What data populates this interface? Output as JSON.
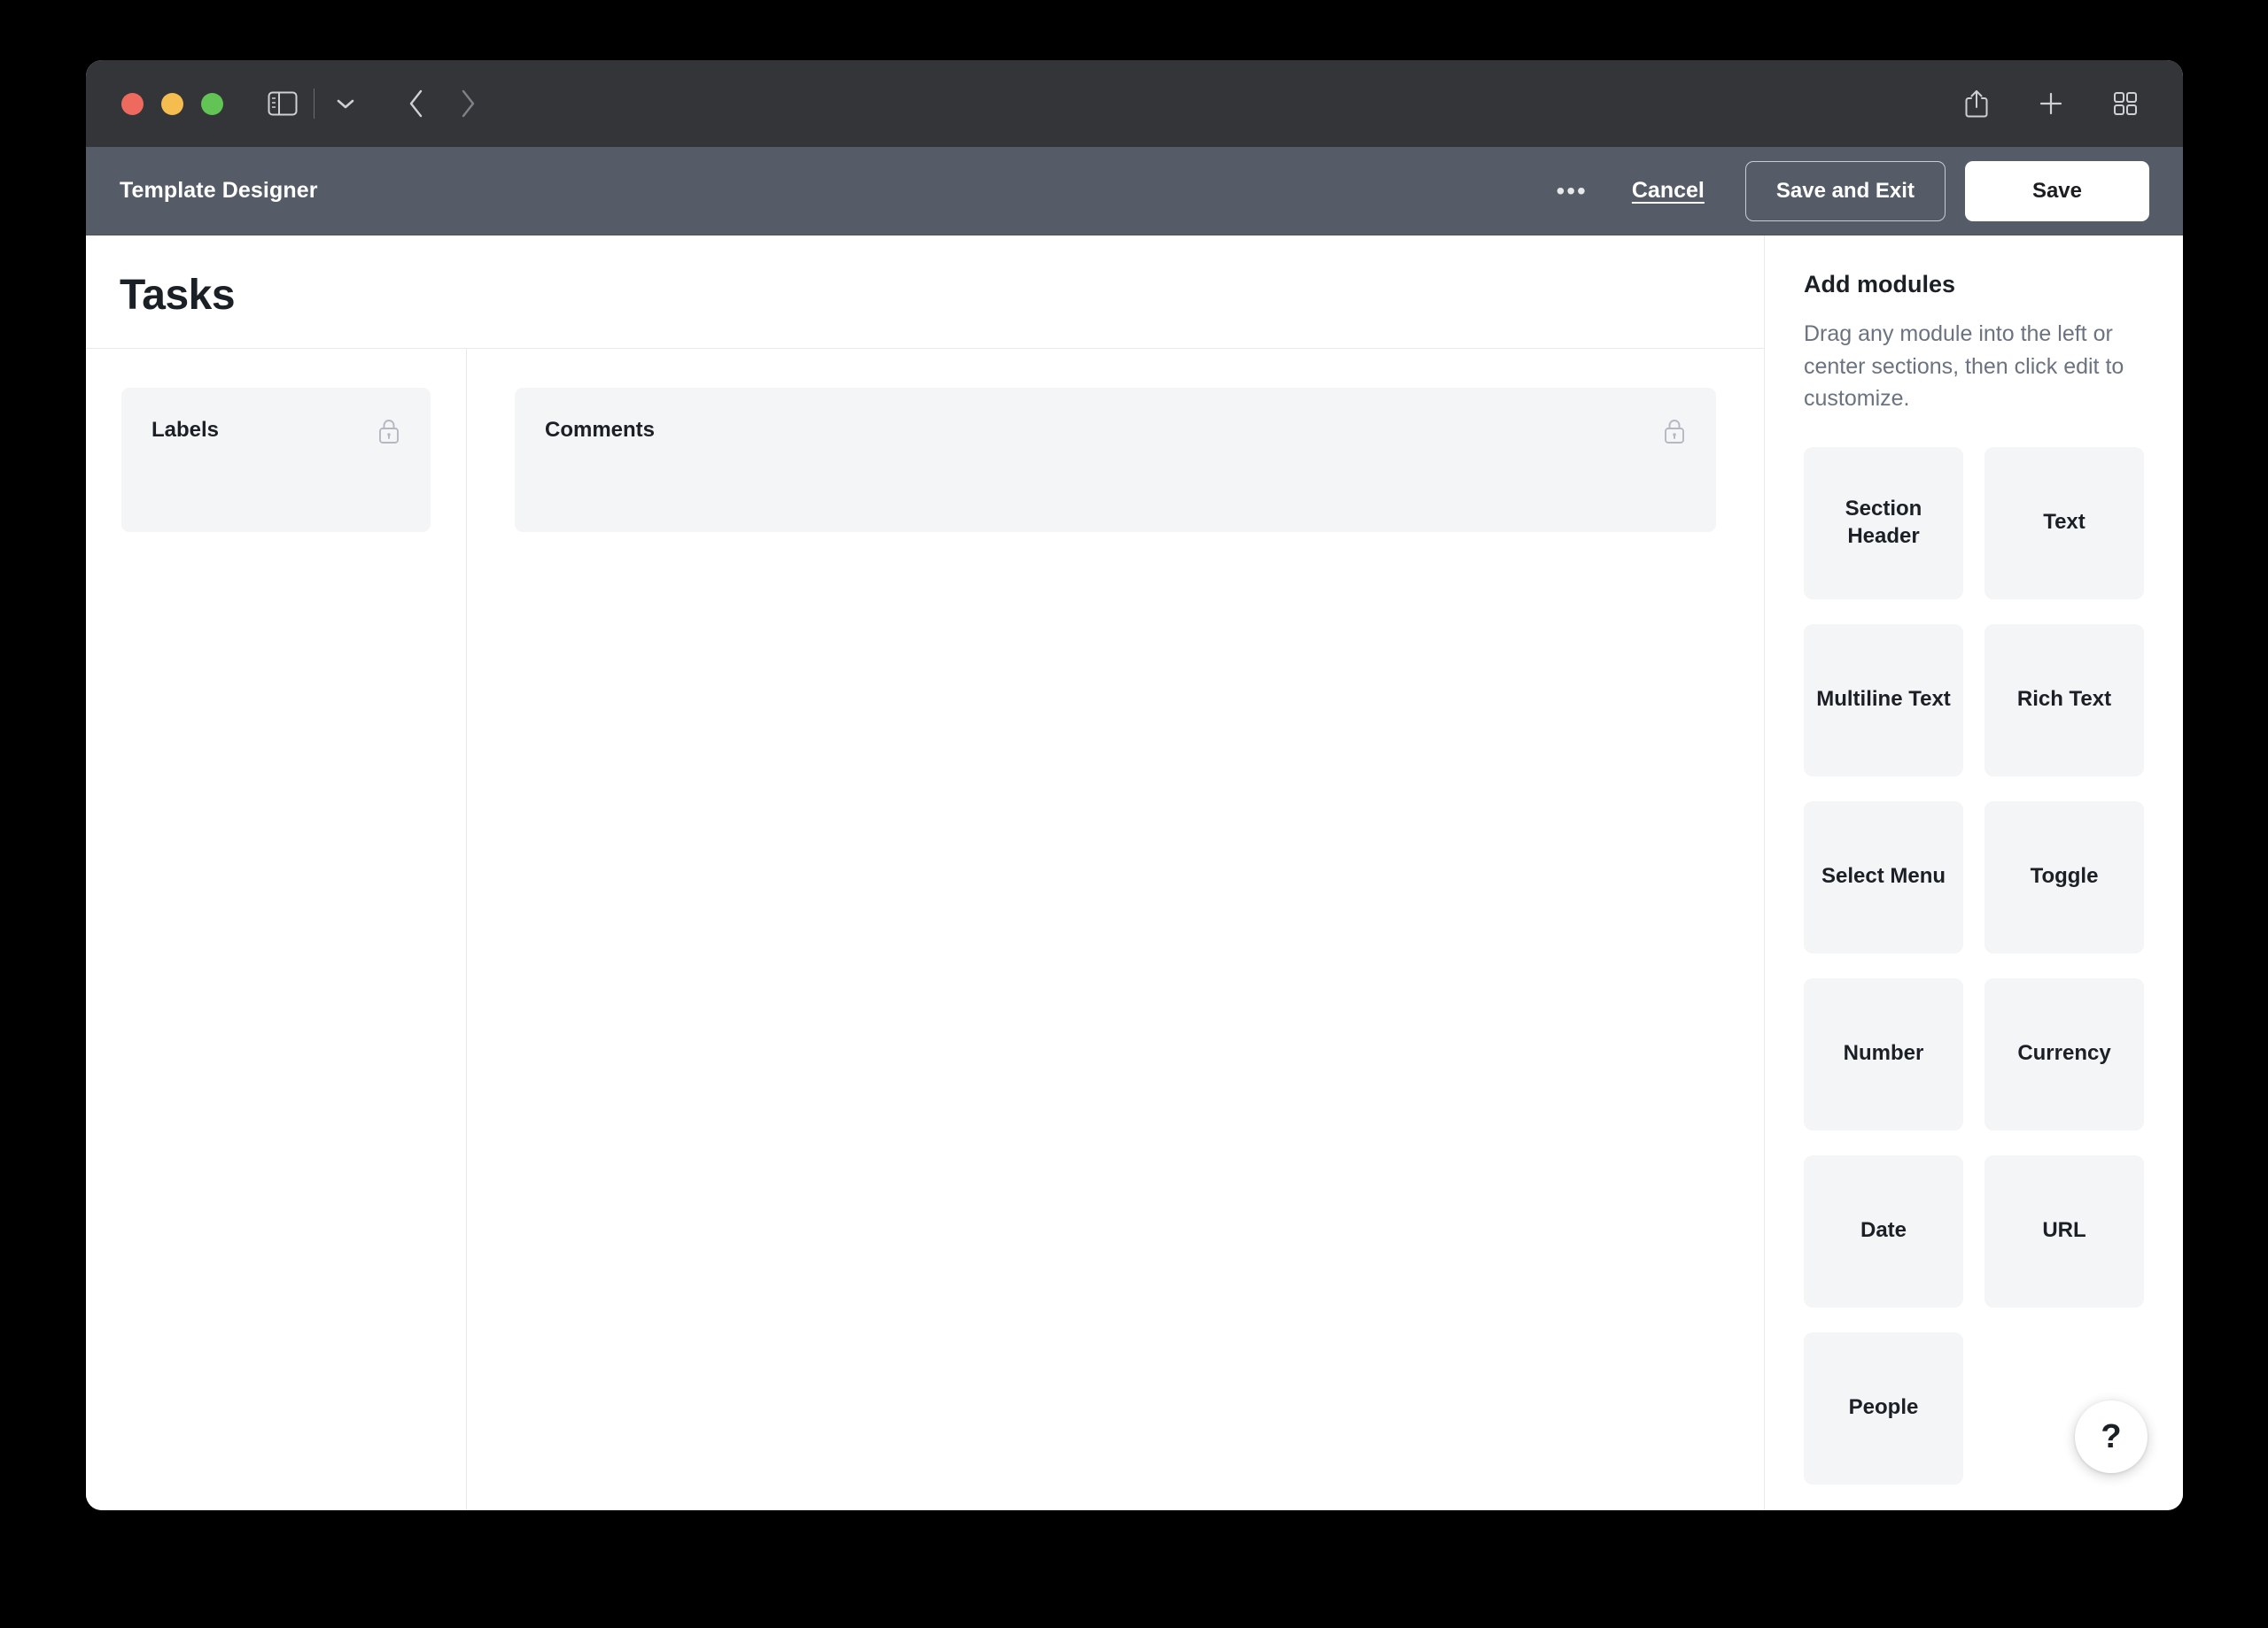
{
  "browser": {
    "icons": {
      "traffic_close": "close-window-dot",
      "traffic_minimize": "minimize-window-dot",
      "traffic_zoom": "zoom-window-dot",
      "sidebar": "sidebar-toggle-icon",
      "chevron": "chevron-down-icon",
      "back": "back-arrow-icon",
      "forward": "forward-arrow-icon",
      "share": "share-icon",
      "new_tab": "plus-icon",
      "tab_overview": "tab-overview-icon"
    }
  },
  "header": {
    "title": "Template Designer",
    "more_label": "•••",
    "cancel_label": "Cancel",
    "save_and_exit_label": "Save and Exit",
    "save_label": "Save"
  },
  "canvas": {
    "title": "Tasks",
    "left_section": [
      {
        "label": "Labels",
        "locked": true
      }
    ],
    "center_section": [
      {
        "label": "Comments",
        "locked": true
      }
    ]
  },
  "panel": {
    "title": "Add modules",
    "description": "Drag any module into the left or center sections, then click edit to customize.",
    "modules": [
      {
        "label": "Section Header"
      },
      {
        "label": "Text"
      },
      {
        "label": "Multiline Text"
      },
      {
        "label": "Rich Text"
      },
      {
        "label": "Select Menu"
      },
      {
        "label": "Toggle"
      },
      {
        "label": "Number"
      },
      {
        "label": "Currency"
      },
      {
        "label": "Date"
      },
      {
        "label": "URL"
      },
      {
        "label": "People"
      }
    ],
    "help_label": "?"
  },
  "colors": {
    "chrome": "#333538",
    "header": "#565c67",
    "accent_text": "#1b1f26",
    "muted_text": "#6b7280",
    "module_bg": "#f4f5f7",
    "lock": "#b3b8c2"
  }
}
